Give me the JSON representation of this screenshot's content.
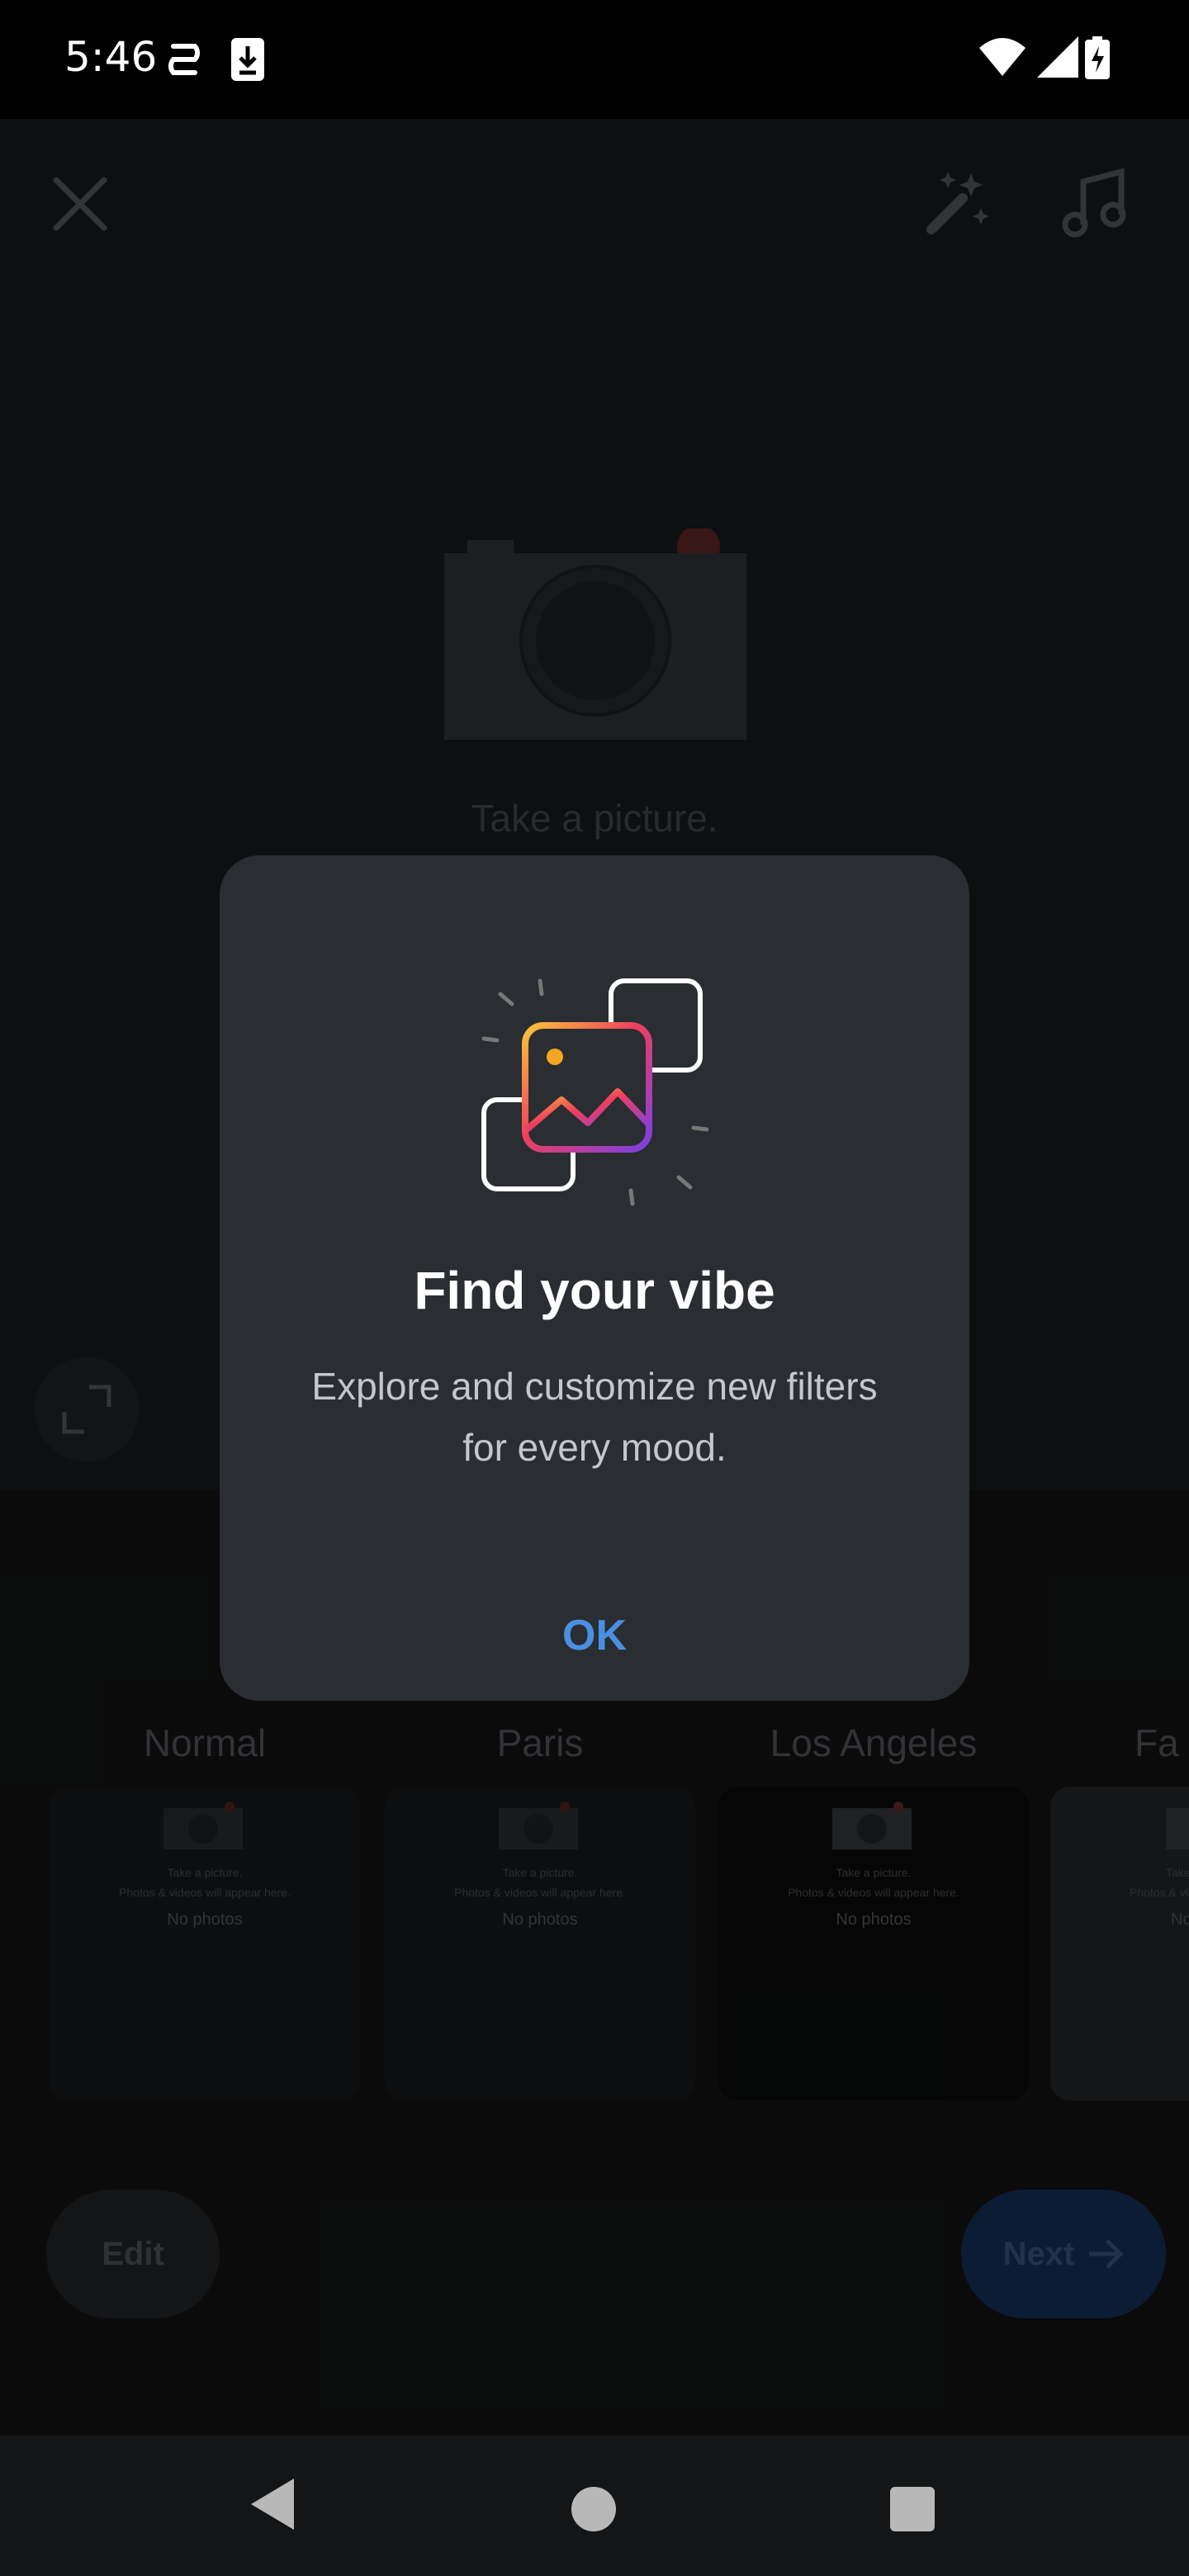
{
  "status_bar": {
    "time": "5:46"
  },
  "top_bar": {
    "close_icon": "close-icon",
    "effects_icon": "magic-wand-icon",
    "music_icon": "music-note-icon"
  },
  "preview": {
    "placeholder_text": "Take a picture."
  },
  "filters": [
    {
      "name": "Normal",
      "line1": "Take a picture.",
      "line2": "Photos & videos will appear here.",
      "empty": "No photos"
    },
    {
      "name": "Paris",
      "line1": "Take a picture.",
      "line2": "Photos & videos will appear here.",
      "empty": "No photos"
    },
    {
      "name": "Los Angeles",
      "line1": "Take a picture.",
      "line2": "Photos & videos will appear here.",
      "empty": "No photos"
    },
    {
      "name": "Fa",
      "line1": "Take a",
      "line2": "Photos & vid",
      "empty": "No"
    }
  ],
  "bottom_bar": {
    "edit_label": "Edit",
    "next_label": "Next"
  },
  "dialog": {
    "title": "Find your vibe",
    "body": "Explore and customize new filters for every mood.",
    "ok_label": "OK"
  },
  "colors": {
    "accent": "#4a90e2",
    "dialog_bg": "#2a2d31"
  }
}
